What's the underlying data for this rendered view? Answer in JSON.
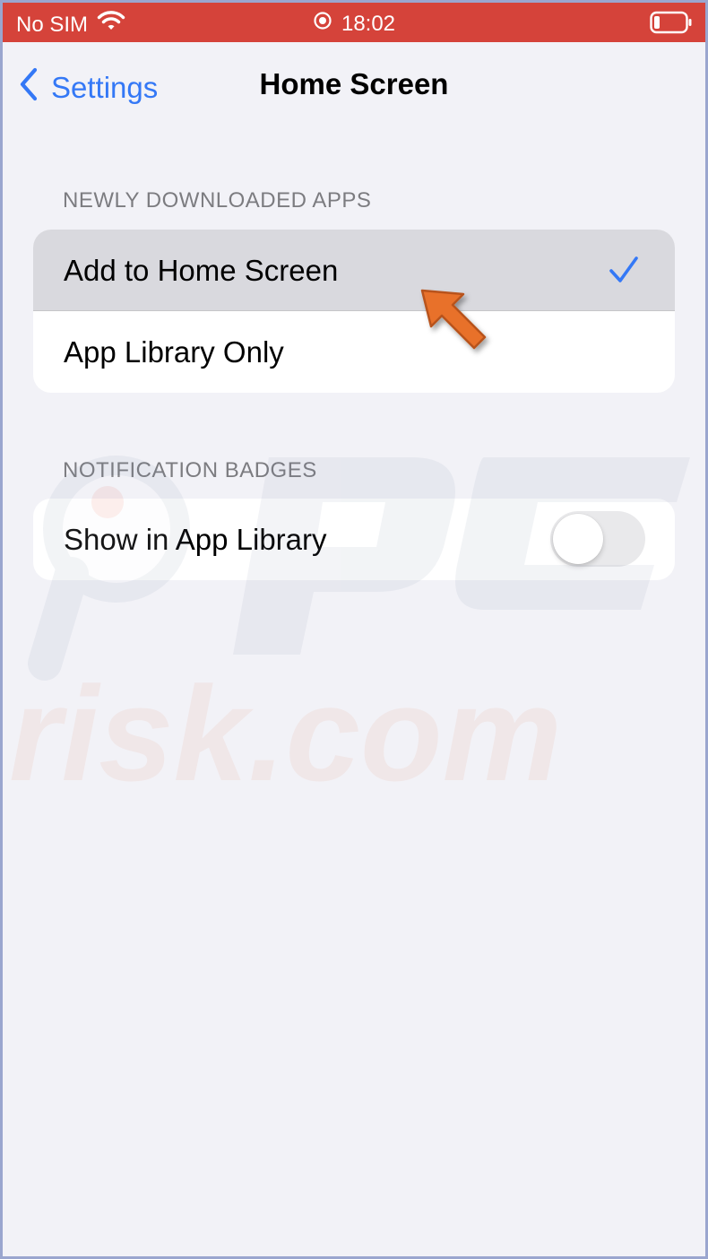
{
  "status_bar": {
    "carrier": "No SIM",
    "time": "18:02",
    "icons": [
      "wifi-icon",
      "location-icon",
      "battery-icon"
    ]
  },
  "nav": {
    "back_label": "Settings",
    "title": "Home Screen",
    "back_icon": "chevron-left-icon"
  },
  "sections": [
    {
      "header": "NEWLY DOWNLOADED APPS",
      "options": [
        {
          "label": "Add to Home Screen",
          "selected": true
        },
        {
          "label": "App Library Only",
          "selected": false
        }
      ]
    },
    {
      "header": "NOTIFICATION BADGES",
      "toggle": {
        "label": "Show in App Library",
        "on": false
      }
    }
  ],
  "annotation": {
    "icon": "orange-pointer-arrow-icon"
  },
  "watermark": {
    "text": "risk.com",
    "logo": "pc"
  },
  "colors": {
    "status_bar": "#d5433a",
    "accent": "#3478f6",
    "background": "#f2f2f7",
    "selected_row": "#d9d9de",
    "arrow": "#e8712a"
  }
}
